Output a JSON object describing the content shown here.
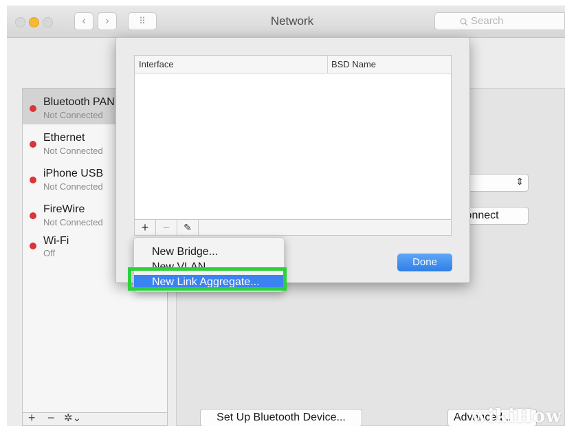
{
  "window": {
    "title": "Network"
  },
  "toolbar": {
    "back_glyph": "‹",
    "forward_glyph": "›",
    "grid_glyph": "⠿",
    "search_placeholder": "Search",
    "traffic_lights": {
      "close": "#d8d8d8",
      "minimize": "#f5b933",
      "zoom": "#d8d8d8"
    }
  },
  "sidebar": {
    "services": [
      {
        "name": "Bluetooth PAN",
        "status": "Not Connected"
      },
      {
        "name": "Ethernet",
        "status": "Not Connected"
      },
      {
        "name": "iPhone USB",
        "status": "Not Connected"
      },
      {
        "name": "FireWire",
        "status": "Not Connected"
      },
      {
        "name": "Wi-Fi",
        "status": "Off"
      }
    ],
    "status_color": "#d9353a",
    "bottom_buttons": {
      "add": "+",
      "remove": "−",
      "gear": "✲⌄"
    }
  },
  "main": {
    "connect_label": "Connect",
    "setup_bluetooth_label": "Set Up Bluetooth Device...",
    "advanced_label": "Advanced..."
  },
  "sheet": {
    "columns": [
      "Interface",
      "BSD Name"
    ],
    "add": "+",
    "remove": "−",
    "edit": "✎",
    "done_label": "Done"
  },
  "menu": {
    "items": [
      "New Bridge...",
      "New VLAN...",
      "New Link Aggregate..."
    ],
    "highlight_color": "#2bd13a"
  },
  "watermark": {
    "wiki": "wiki",
    "how": "How"
  }
}
